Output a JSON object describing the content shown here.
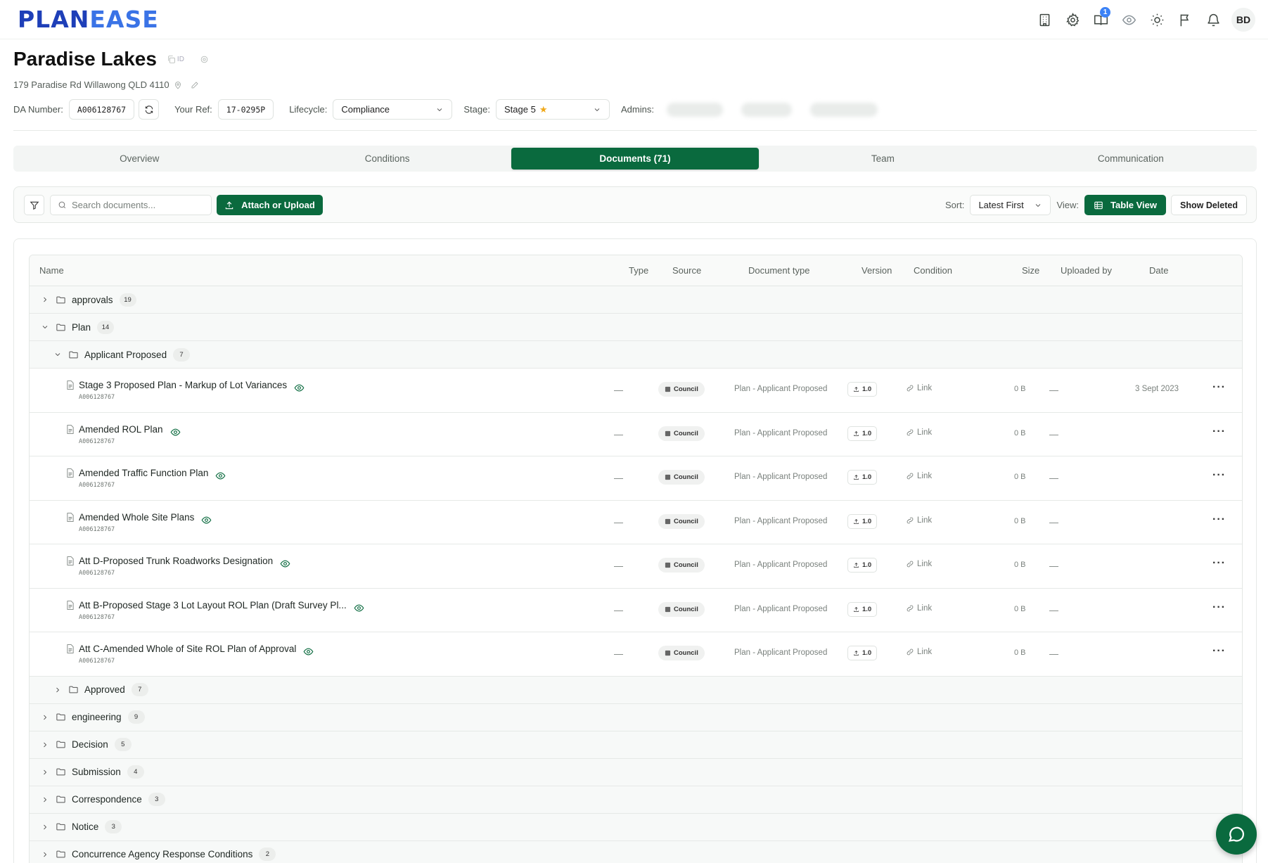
{
  "app": {
    "logo_part1": "PLAN",
    "logo_part2": "EASE",
    "avatar_initials": "BD",
    "notification_count": "1"
  },
  "project": {
    "title": "Paradise Lakes",
    "id_label": "ID",
    "address": "179 Paradise Rd Willawong QLD 4110",
    "da_label": "DA Number:",
    "da_number": "A006128767",
    "ref_label": "Your Ref:",
    "ref_value": "17-0295P",
    "lifecycle_label": "Lifecycle:",
    "lifecycle_value": "Compliance",
    "stage_label": "Stage:",
    "stage_value": "Stage 5",
    "admins_label": "Admins:"
  },
  "tabs": [
    "Overview",
    "Conditions",
    "Documents (71)",
    "Team",
    "Communication"
  ],
  "toolbar": {
    "search_placeholder": "Search documents...",
    "upload_label": "Attach or Upload",
    "sort_label": "Sort:",
    "sort_value": "Latest First",
    "view_label": "View:",
    "view_value": "Table View",
    "show_deleted": "Show Deleted"
  },
  "columns": {
    "name": "Name",
    "type": "Type",
    "source": "Source",
    "doctype": "Document type",
    "version": "Version",
    "condition": "Condition",
    "size": "Size",
    "uploaded_by": "Uploaded by",
    "date": "Date"
  },
  "folders_top": [
    {
      "name": "approvals",
      "count": "19"
    },
    {
      "name": "Plan",
      "count": "14"
    }
  ],
  "subfolder_open": {
    "name": "Applicant Proposed",
    "count": "7"
  },
  "documents": [
    {
      "name": "Stage 3 Proposed Plan - Markup of Lot Variances",
      "sub": "A006128767",
      "type": "—",
      "source": "Council",
      "doctype": "Plan - Applicant Proposed",
      "version": "1.0",
      "condition": "Link",
      "size": "0 B",
      "uploaded_by": "—",
      "date": "3 Sept 2023"
    },
    {
      "name": "Amended ROL Plan",
      "sub": "A006128767",
      "type": "—",
      "source": "Council",
      "doctype": "Plan - Applicant Proposed",
      "version": "1.0",
      "condition": "Link",
      "size": "0 B",
      "uploaded_by": "—",
      "date": ""
    },
    {
      "name": "Amended Traffic Function Plan",
      "sub": "A006128767",
      "type": "—",
      "source": "Council",
      "doctype": "Plan - Applicant Proposed",
      "version": "1.0",
      "condition": "Link",
      "size": "0 B",
      "uploaded_by": "—",
      "date": ""
    },
    {
      "name": "Amended Whole Site Plans",
      "sub": "A006128767",
      "type": "—",
      "source": "Council",
      "doctype": "Plan - Applicant Proposed",
      "version": "1.0",
      "condition": "Link",
      "size": "0 B",
      "uploaded_by": "—",
      "date": ""
    },
    {
      "name": "Att D-Proposed Trunk Roadworks Designation",
      "sub": "A006128767",
      "type": "—",
      "source": "Council",
      "doctype": "Plan - Applicant Proposed",
      "version": "1.0",
      "condition": "Link",
      "size": "0 B",
      "uploaded_by": "—",
      "date": ""
    },
    {
      "name": "Att B-Proposed Stage 3 Lot Layout ROL Plan (Draft Survey Pl...",
      "sub": "A006128767",
      "type": "—",
      "source": "Council",
      "doctype": "Plan - Applicant Proposed",
      "version": "1.0",
      "condition": "Link",
      "size": "0 B",
      "uploaded_by": "—",
      "date": ""
    },
    {
      "name": "Att C-Amended Whole of Site ROL Plan of Approval",
      "sub": "A006128767",
      "type": "—",
      "source": "Council",
      "doctype": "Plan - Applicant Proposed",
      "version": "1.0",
      "condition": "Link",
      "size": "0 B",
      "uploaded_by": "—",
      "date": ""
    }
  ],
  "subfolder_closed": {
    "name": "Approved",
    "count": "7"
  },
  "folders_bottom": [
    {
      "name": "engineering",
      "count": "9"
    },
    {
      "name": "Decision",
      "count": "5"
    },
    {
      "name": "Submission",
      "count": "4"
    },
    {
      "name": "Correspondence",
      "count": "3"
    },
    {
      "name": "Notice",
      "count": "3"
    },
    {
      "name": "Concurrence Agency Response Conditions",
      "count": "2"
    }
  ]
}
